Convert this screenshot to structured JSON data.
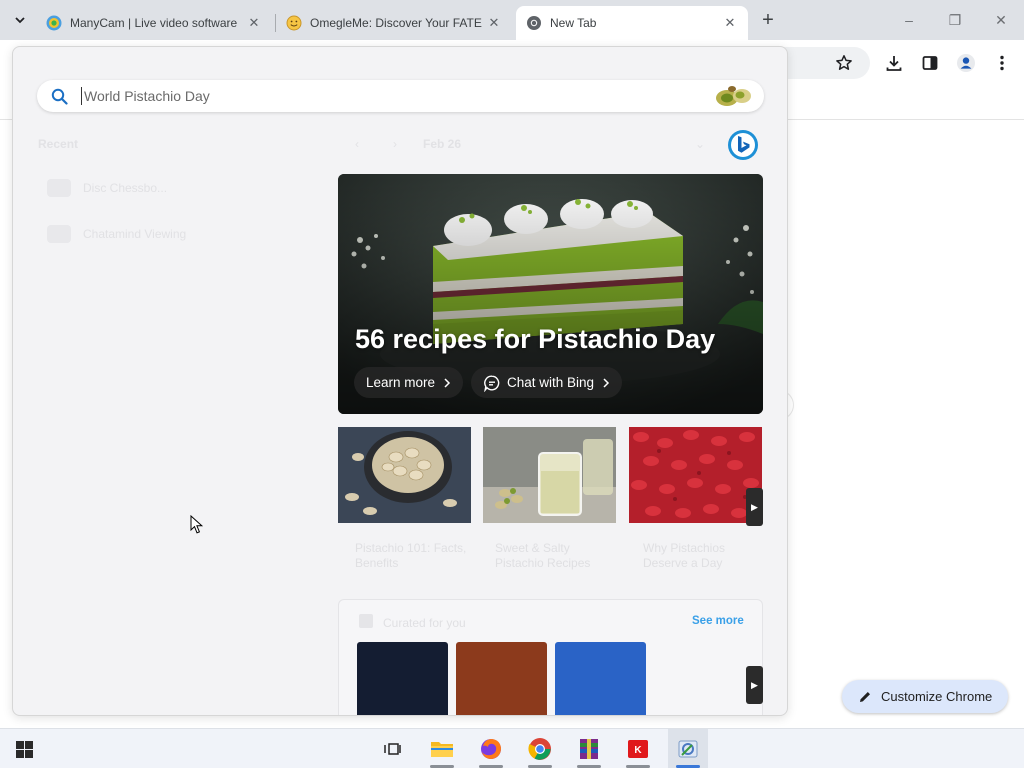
{
  "tabs": [
    {
      "title": "ManyCam | Live video software",
      "icon": "manycam-icon",
      "active": false
    },
    {
      "title": "OmegleMe: Discover Your FATE",
      "icon": "smiley-icon",
      "active": false
    },
    {
      "title": "New Tab",
      "icon": "chrome-icon",
      "active": true
    }
  ],
  "newtab_symbol": "+",
  "window_controls": {
    "minimize": "–",
    "restore": "❐",
    "close": "✕"
  },
  "overlay": {
    "search": {
      "placeholder": "World Pistachio Day"
    },
    "recent": {
      "title": "Recent",
      "items": [
        "Disc Chessbo...",
        "Chatamind Viewing"
      ]
    },
    "date_nav": {
      "prev": "‹",
      "next": "›",
      "date": "Feb 26",
      "caret": "⌄"
    },
    "hero": {
      "title": "56 recipes for Pistachio Day",
      "learn_more": "Learn more",
      "chat_with_bing": "Chat with Bing"
    },
    "cards": [
      {
        "caption": "Pistachio 101: Facts, Benefits"
      },
      {
        "caption": "Sweet & Salty Pistachio Recipes"
      },
      {
        "caption": "Why Pistachios Deserve a Day"
      }
    ],
    "curated": {
      "title": "Curated for you",
      "see_more": "See more",
      "swatches": [
        "#141d32",
        "#8c3a1c",
        "#2a63c6"
      ]
    }
  },
  "customize_chrome": "Customize Chrome",
  "colors": {
    "accent_blue": "#3aa0e8",
    "customize_bg": "#dce7fb",
    "overlay_bg": "#f3f3f5"
  },
  "taskbar": [
    "windows-start-icon",
    "task-view-icon",
    "file-explorer-icon",
    "firefox-icon",
    "chrome-icon",
    "winrar-icon",
    "app-red-icon",
    "control-panel-icon"
  ]
}
